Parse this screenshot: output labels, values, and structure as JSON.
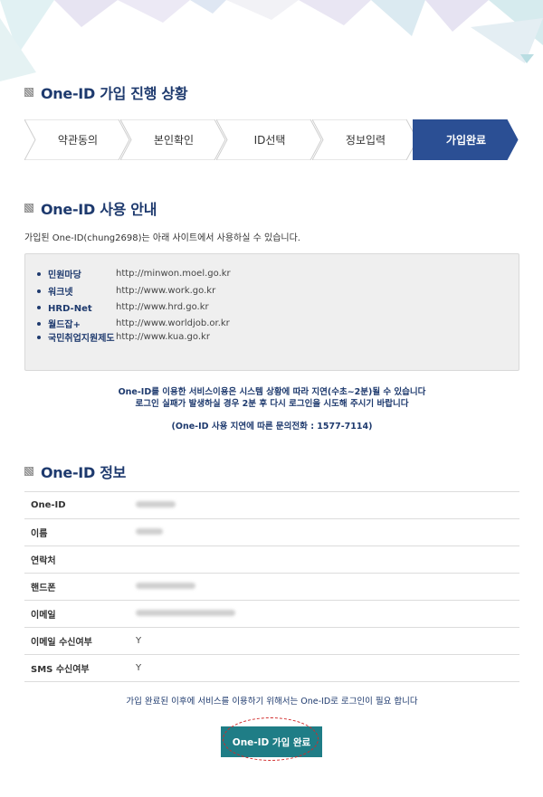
{
  "progress": {
    "title": "One-ID 가입 진행 상황",
    "steps": [
      "약관동의",
      "본인확인",
      "ID선택",
      "정보입력",
      "가입완료"
    ],
    "active_step": "가입완료"
  },
  "usage": {
    "title": "One-ID 사용 안내",
    "intro": "가입된 One-ID(chung2698)는 아래 사이트에서 사용하실 수 있습니다.",
    "sites": [
      {
        "name": "민원마당",
        "url": "http://minwon.moel.go.kr"
      },
      {
        "name": "워크넷",
        "url": "http://www.work.go.kr"
      },
      {
        "name": "HRD-Net",
        "url": "http://www.hrd.go.kr"
      },
      {
        "name": "월드잡+",
        "url": "http://www.worldjob.or.kr"
      },
      {
        "name": "국민취업지원제도",
        "url": "http://www.kua.go.kr"
      }
    ],
    "notice_line1": "One-ID를 이용한 서비스이용은 시스템 상황에 따라 지연(수초~2분)될 수 있습니다",
    "notice_line2": "로그인 실패가 발생하실 경우 2분 후 다시 로그인을 시도해 주시기 바랍니다",
    "contact": "(One-ID 사용 지연에 따른 문의전화 : 1577-7114)"
  },
  "info": {
    "title": "One-ID 정보",
    "rows": [
      {
        "label": "One-ID",
        "value": "",
        "blurred": true
      },
      {
        "label": "이름",
        "value": "",
        "blurred": true
      },
      {
        "label": "연락처",
        "value": "",
        "blurred": false
      },
      {
        "label": "핸드폰",
        "value": "",
        "blurred": true
      },
      {
        "label": "이메일",
        "value": "",
        "blurred": true
      },
      {
        "label": "이메일 수신여부",
        "value": "Y",
        "blurred": false
      },
      {
        "label": "SMS 수신여부",
        "value": "Y",
        "blurred": false
      }
    ]
  },
  "footnote": "가입 완료된 이후에 서비스를 이용하기 위해서는 One-ID로 로그인이 필요 합니다",
  "complete_button": "One-ID 가입 완료",
  "colors": {
    "navy": "#1e3a6e",
    "active_step": "#2b4f94",
    "button": "#1f7d86",
    "highlight_ring": "#d12b2b"
  }
}
